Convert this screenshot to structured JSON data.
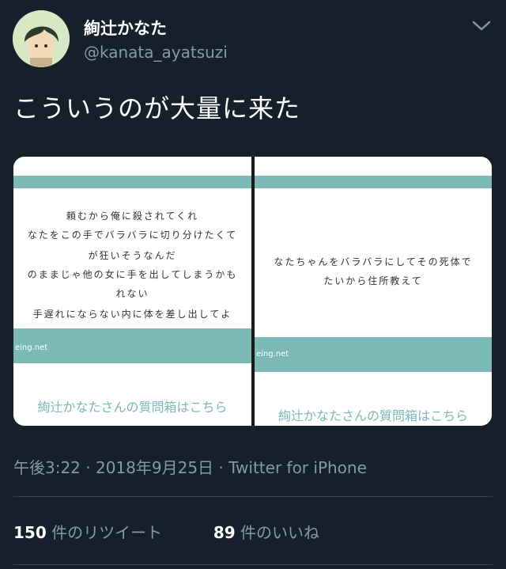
{
  "user": {
    "display_name": "絢辻かなた",
    "handle": "@kanata_ayatsuzi"
  },
  "tweet": {
    "text": "こういうのが大量に来た",
    "time": "午後3:22 · 2018年9月25日 · ",
    "source": "Twitter for iPhone"
  },
  "media": {
    "left": {
      "lines": [
        "頼むから俺に殺されてくれ",
        "なたをこの手でバラバラに切り分けたくて",
        "が狂いそうなんだ",
        "のままじゃ他の女に手を出してしまうかも",
        "れない",
        "手遅れにならない内に体を差し出してよ"
      ],
      "site": "eing.net",
      "link": "絢辻かなたさんの質問箱はこちら"
    },
    "right": {
      "lines": [
        "なたちゃんをバラバラにしてその死体で",
        "たいから住所教えて"
      ],
      "site": "eing.net",
      "link": "絢辻かなたさんの質問箱はこちら"
    }
  },
  "stats": {
    "retweets_count": "150",
    "retweets_label": " 件のリツイート",
    "likes_count": "89",
    "likes_label": " 件のいいね"
  },
  "colors": {
    "background": "#15202b",
    "secondary_text": "#8899a6",
    "teal_accent": "#7ab9b5"
  }
}
